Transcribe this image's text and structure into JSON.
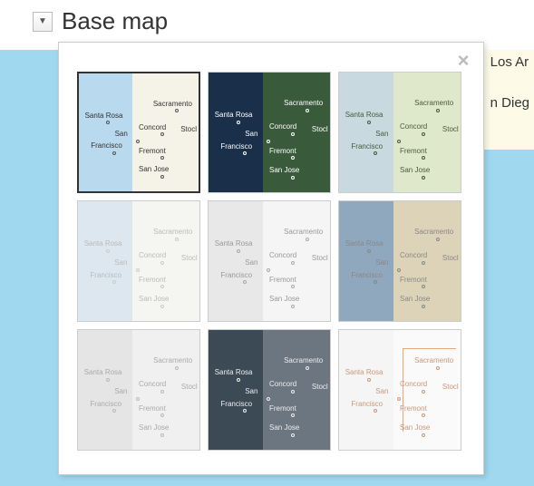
{
  "header": {
    "title": "Base map"
  },
  "bg_cities": {
    "la": "Los Ar",
    "sd": "n Dieg"
  },
  "panel": {
    "close": "×",
    "styles": [
      {
        "id": "classic",
        "selected": true
      },
      {
        "id": "satellite",
        "selected": false
      },
      {
        "id": "terrain",
        "selected": false
      },
      {
        "id": "light",
        "selected": false
      },
      {
        "id": "gray",
        "selected": false
      },
      {
        "id": "tan",
        "selected": false
      },
      {
        "id": "muted",
        "selected": false
      },
      {
        "id": "dark",
        "selected": false
      },
      {
        "id": "orange",
        "selected": false
      }
    ],
    "thumb_cities": {
      "sacramento": "Sacramento",
      "santa_rosa": "Santa Rosa",
      "concord": "Concord",
      "stockton": "Stocl",
      "san": "San",
      "francisco": "Francisco",
      "fremont": "Fremont",
      "san_jose": "San Jose"
    }
  }
}
